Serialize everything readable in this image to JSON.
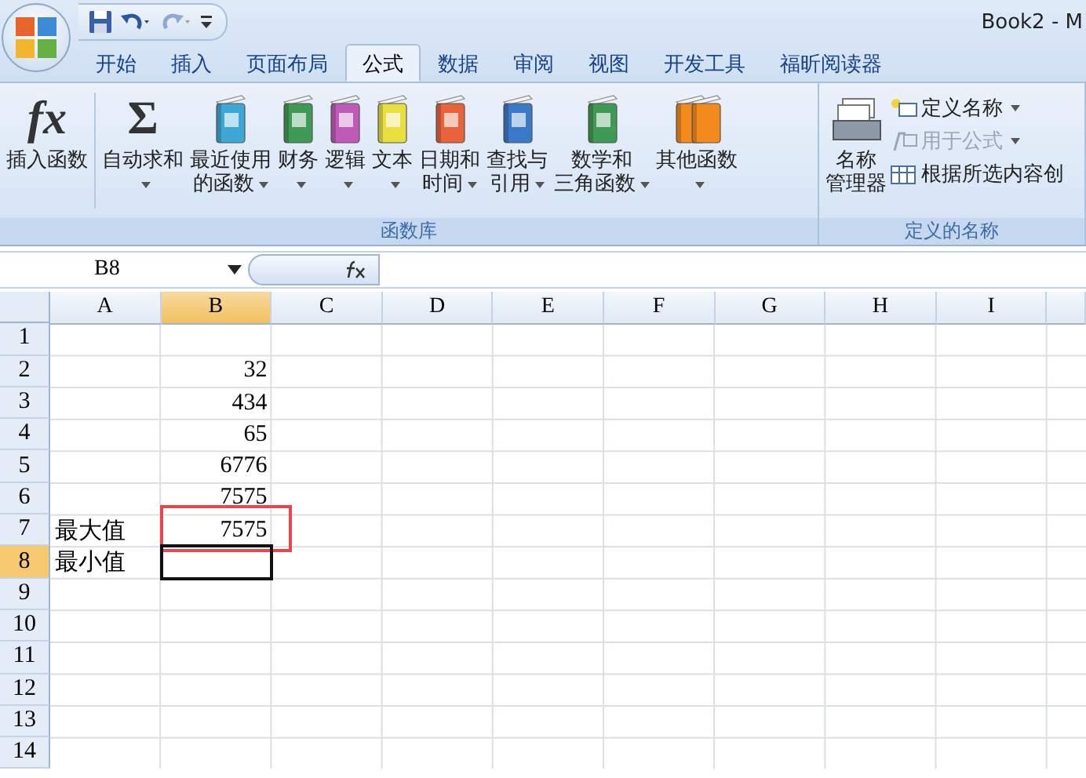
{
  "window": {
    "title": "Book2 - M"
  },
  "quick_access": [
    {
      "kind": "save",
      "disabled": false
    },
    {
      "kind": "undo",
      "disabled": false
    },
    {
      "kind": "redo",
      "disabled": true
    },
    {
      "kind": "customize",
      "disabled": false
    }
  ],
  "tabs": [
    {
      "label": "开始",
      "selected": false
    },
    {
      "label": "插入",
      "selected": false
    },
    {
      "label": "页面布局",
      "selected": false
    },
    {
      "label": "公式",
      "selected": true
    },
    {
      "label": "数据",
      "selected": false
    },
    {
      "label": "审阅",
      "selected": false
    },
    {
      "label": "视图",
      "selected": false
    },
    {
      "label": "开发工具",
      "selected": false
    },
    {
      "label": "福昕阅读器",
      "selected": false
    }
  ],
  "ribbon": {
    "function_library": {
      "label": "函数库",
      "buttons": [
        {
          "kind": "glyph",
          "glyph": "fx",
          "lines": [
            "插入函数"
          ],
          "dropdown": false
        },
        {
          "kind": "glyph",
          "glyph": "Σ",
          "lines": [
            "自动求和"
          ],
          "dropdown": true
        },
        {
          "kind": "book",
          "color": "#3fa7d6",
          "lines": [
            "最近使用",
            "的函数"
          ],
          "dropdown": true
        },
        {
          "kind": "book",
          "color": "#3f9a55",
          "lines": [
            "财务"
          ],
          "dropdown": true
        },
        {
          "kind": "book",
          "color": "#c05ab8",
          "lines": [
            "逻辑"
          ],
          "dropdown": true
        },
        {
          "kind": "book",
          "color": "#e8e040",
          "lines": [
            "文本"
          ],
          "dropdown": true
        },
        {
          "kind": "book",
          "color": "#e8623a",
          "lines": [
            "日期和",
            "时间"
          ],
          "dropdown": true
        },
        {
          "kind": "book",
          "color": "#3a78c8",
          "lines": [
            "查找与",
            "引用"
          ],
          "dropdown": true
        },
        {
          "kind": "book",
          "color": "#3f9a55",
          "lines": [
            "数学和",
            "三角函数"
          ],
          "dropdown": true
        },
        {
          "kind": "books",
          "color": "#f28a1e",
          "lines": [
            "其他函数"
          ],
          "dropdown": true
        }
      ]
    },
    "defined_names": {
      "label": "定义的名称",
      "manager": {
        "lines": [
          "名称",
          "管理器"
        ]
      },
      "items": [
        {
          "kind": "tag",
          "label": "定义名称",
          "dropdown": true,
          "disabled": false
        },
        {
          "kind": "formula",
          "label": "用于公式",
          "dropdown": true,
          "disabled": true
        },
        {
          "kind": "table",
          "label": "根据所选内容创",
          "dropdown": false,
          "disabled": false
        }
      ]
    }
  },
  "formula_bar": {
    "name_box": "B8"
  },
  "sheet": {
    "columns": [
      {
        "label": "A",
        "selected": false
      },
      {
        "label": "B",
        "selected": true
      },
      {
        "label": "C",
        "selected": false
      },
      {
        "label": "D",
        "selected": false
      },
      {
        "label": "E",
        "selected": false
      },
      {
        "label": "F",
        "selected": false
      },
      {
        "label": "G",
        "selected": false
      },
      {
        "label": "H",
        "selected": false
      },
      {
        "label": "I",
        "selected": false
      }
    ],
    "rows": [
      {
        "header": "1",
        "selected": false,
        "cells": []
      },
      {
        "header": "2",
        "selected": false,
        "cells": [
          null,
          {
            "kind": "number",
            "text": "32",
            "marked": false
          }
        ]
      },
      {
        "header": "3",
        "selected": false,
        "cells": [
          null,
          {
            "kind": "number",
            "text": "434",
            "marked": false
          }
        ]
      },
      {
        "header": "4",
        "selected": false,
        "cells": [
          null,
          {
            "kind": "number",
            "text": "65",
            "marked": false
          }
        ]
      },
      {
        "header": "5",
        "selected": false,
        "cells": [
          null,
          {
            "kind": "number",
            "text": "6776",
            "marked": false
          }
        ]
      },
      {
        "header": "6",
        "selected": false,
        "cells": [
          null,
          {
            "kind": "number",
            "text": "7575",
            "marked": false
          }
        ]
      },
      {
        "header": "7",
        "selected": false,
        "cells": [
          {
            "kind": "text",
            "text": "最大值",
            "marked": false
          },
          {
            "kind": "number",
            "text": "7575",
            "marked": true
          }
        ]
      },
      {
        "header": "8",
        "selected": true,
        "cells": [
          {
            "kind": "text",
            "text": "最小值",
            "marked": false
          }
        ]
      },
      {
        "header": "9",
        "selected": false,
        "cells": []
      },
      {
        "header": "10",
        "selected": false,
        "cells": []
      },
      {
        "header": "11",
        "selected": false,
        "cells": []
      },
      {
        "header": "12",
        "selected": false,
        "cells": []
      },
      {
        "header": "13",
        "selected": false,
        "cells": []
      },
      {
        "header": "14",
        "selected": false,
        "cells": []
      }
    ]
  }
}
